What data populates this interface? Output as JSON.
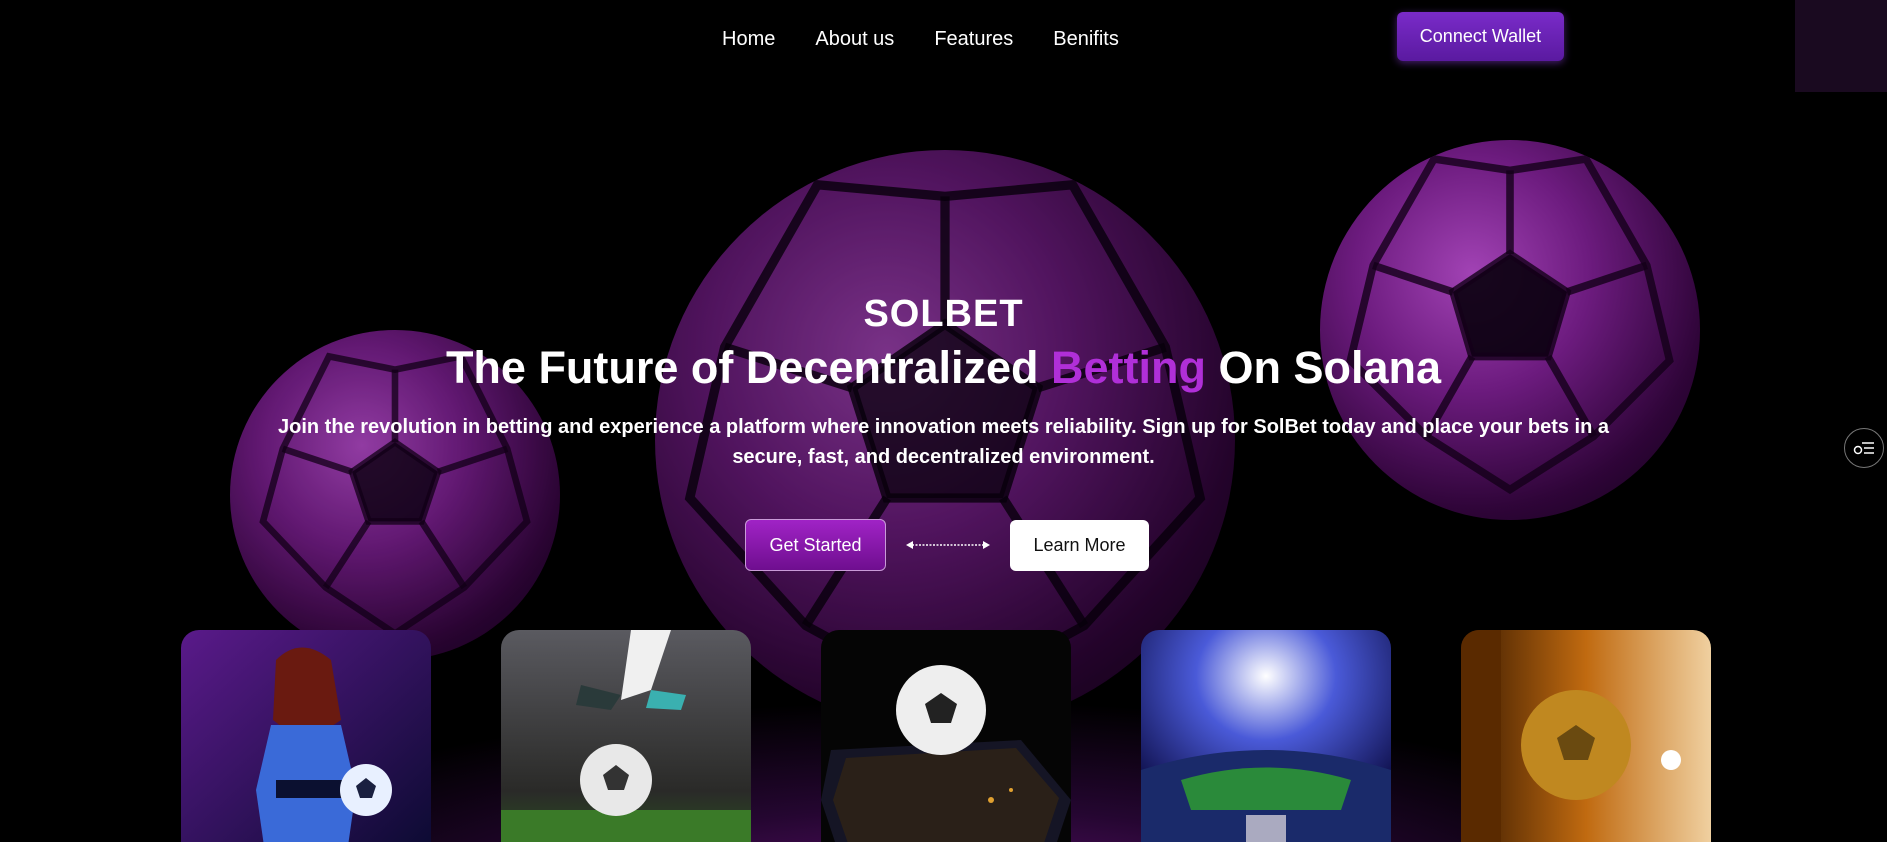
{
  "nav": {
    "items": [
      {
        "label": "Home"
      },
      {
        "label": "About us"
      },
      {
        "label": "Features"
      },
      {
        "label": "Benifits"
      }
    ],
    "connect_label": "Connect Wallet"
  },
  "hero": {
    "brand": "SOLBET",
    "headline_pre": "The Future of Decentralized ",
    "headline_accent": "Betting",
    "headline_post": " On Solana",
    "subtext": "Join the revolution in betting and experience a platform where innovation meets reliability. Sign up for SolBet today and place your bets in a secure, fast, and decentralized environment.",
    "primary_label": "Get Started",
    "secondary_label": "Learn More"
  },
  "cards": [
    {
      "icon": "player-with-ball-image"
    },
    {
      "icon": "kicking-ball-image"
    },
    {
      "icon": "ball-on-phone-image"
    },
    {
      "icon": "stadium-image"
    },
    {
      "icon": "golden-ball-image"
    }
  ],
  "colors": {
    "accent": "#b02fd8",
    "button_purple": "#7a2bc9",
    "background": "#000000"
  }
}
